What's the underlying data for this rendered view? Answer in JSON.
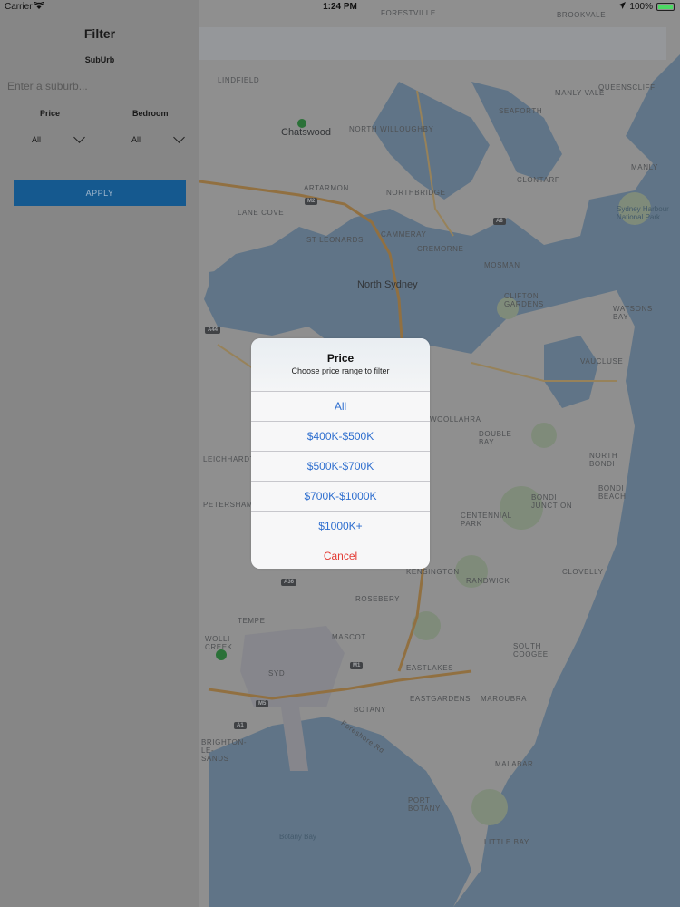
{
  "status_bar": {
    "carrier": "Carrier",
    "time": "1:24 PM",
    "battery": "100%",
    "battery_level": 1.0
  },
  "filter": {
    "title": "Filter",
    "suburb_label": "SubUrb",
    "suburb_placeholder": "Enter a suburb...",
    "price_label": "Price",
    "price_value": "All",
    "bedroom_label": "Bedroom",
    "bedroom_value": "All",
    "apply_label": "APPLY"
  },
  "map": {
    "labels": {
      "forestville": "FORESTVILLE",
      "brookvale": "BROOKVALE",
      "lindfield": "LINDFIELD",
      "manly_vale": "MANLY VALE",
      "queenscliff": "QUEENSCLIFF",
      "seaforth": "SEAFORTH",
      "chatswood": "Chatswood",
      "north_willoughby": "NORTH WILLOUGHBY",
      "artarmon": "ARTARMON",
      "northbridge": "NORTHBRIDGE",
      "clontarf": "CLONTARF",
      "manly": "MANLY",
      "lane_cove": "LANE COVE",
      "st_leonards": "ST LEONARDS",
      "cammeray": "CAMMERAY",
      "cremorne": "CREMORNE",
      "mosman": "MOSMAN",
      "north_sydney": "North Sydney",
      "sydney_harbour_np": "Sydney Harbour National Park",
      "clifton_gardens": "CLIFTON GARDENS",
      "watsons_bay": "WATSONS BAY",
      "vaucluse": "VAUCLUSE",
      "woolahra": "WOOLLAHRA",
      "double_bay": "DOUBLE BAY",
      "north_bondi": "NORTH BONDI",
      "bondi_beach": "BONDI BEACH",
      "bondi_junction": "BONDI JUNCTION",
      "centennial_park": "CENTENNIAL PARK",
      "kensington": "KENSINGTON",
      "randwick": "RANDWICK",
      "clovelly": "CLOVELLY",
      "rosebery": "ROSEBERY",
      "tempe": "TEMPE",
      "mascot": "MASCOT",
      "eastlakes": "EASTLAKES",
      "south_coogee": "SOUTH COOGEE",
      "syd": "SYD",
      "botany": "BOTANY",
      "eastgardens": "EASTGARDENS",
      "maroubra": "MAROUBRA",
      "malabar": "MALABAR",
      "port_botany": "PORT BOTANY",
      "botany_bay": "Botany Bay",
      "little_bay": "LITTLE BAY",
      "petersham": "PETERSHAM",
      "leichhardt": "LEICHHARDT",
      "wolli_creek": "WOLLI CREEK",
      "brighton_le_sands": "BRIGHTON-LE-SANDS"
    },
    "roads": {
      "m2": "M2",
      "a8": "A8",
      "a44": "A44",
      "a36": "A36",
      "m1": "M1",
      "m5": "M5",
      "a1": "A1",
      "foreshore": "Foreshore Rd"
    }
  },
  "price_sheet": {
    "title": "Price",
    "message": "Choose price range to filter",
    "options": [
      "All",
      "$400K-$500K",
      "$500K-$700K",
      "$700K-$1000K",
      "$1000K+"
    ],
    "cancel_label": "Cancel",
    "colors": {
      "option": "#2f6fcf",
      "cancel": "#e33b34"
    }
  }
}
